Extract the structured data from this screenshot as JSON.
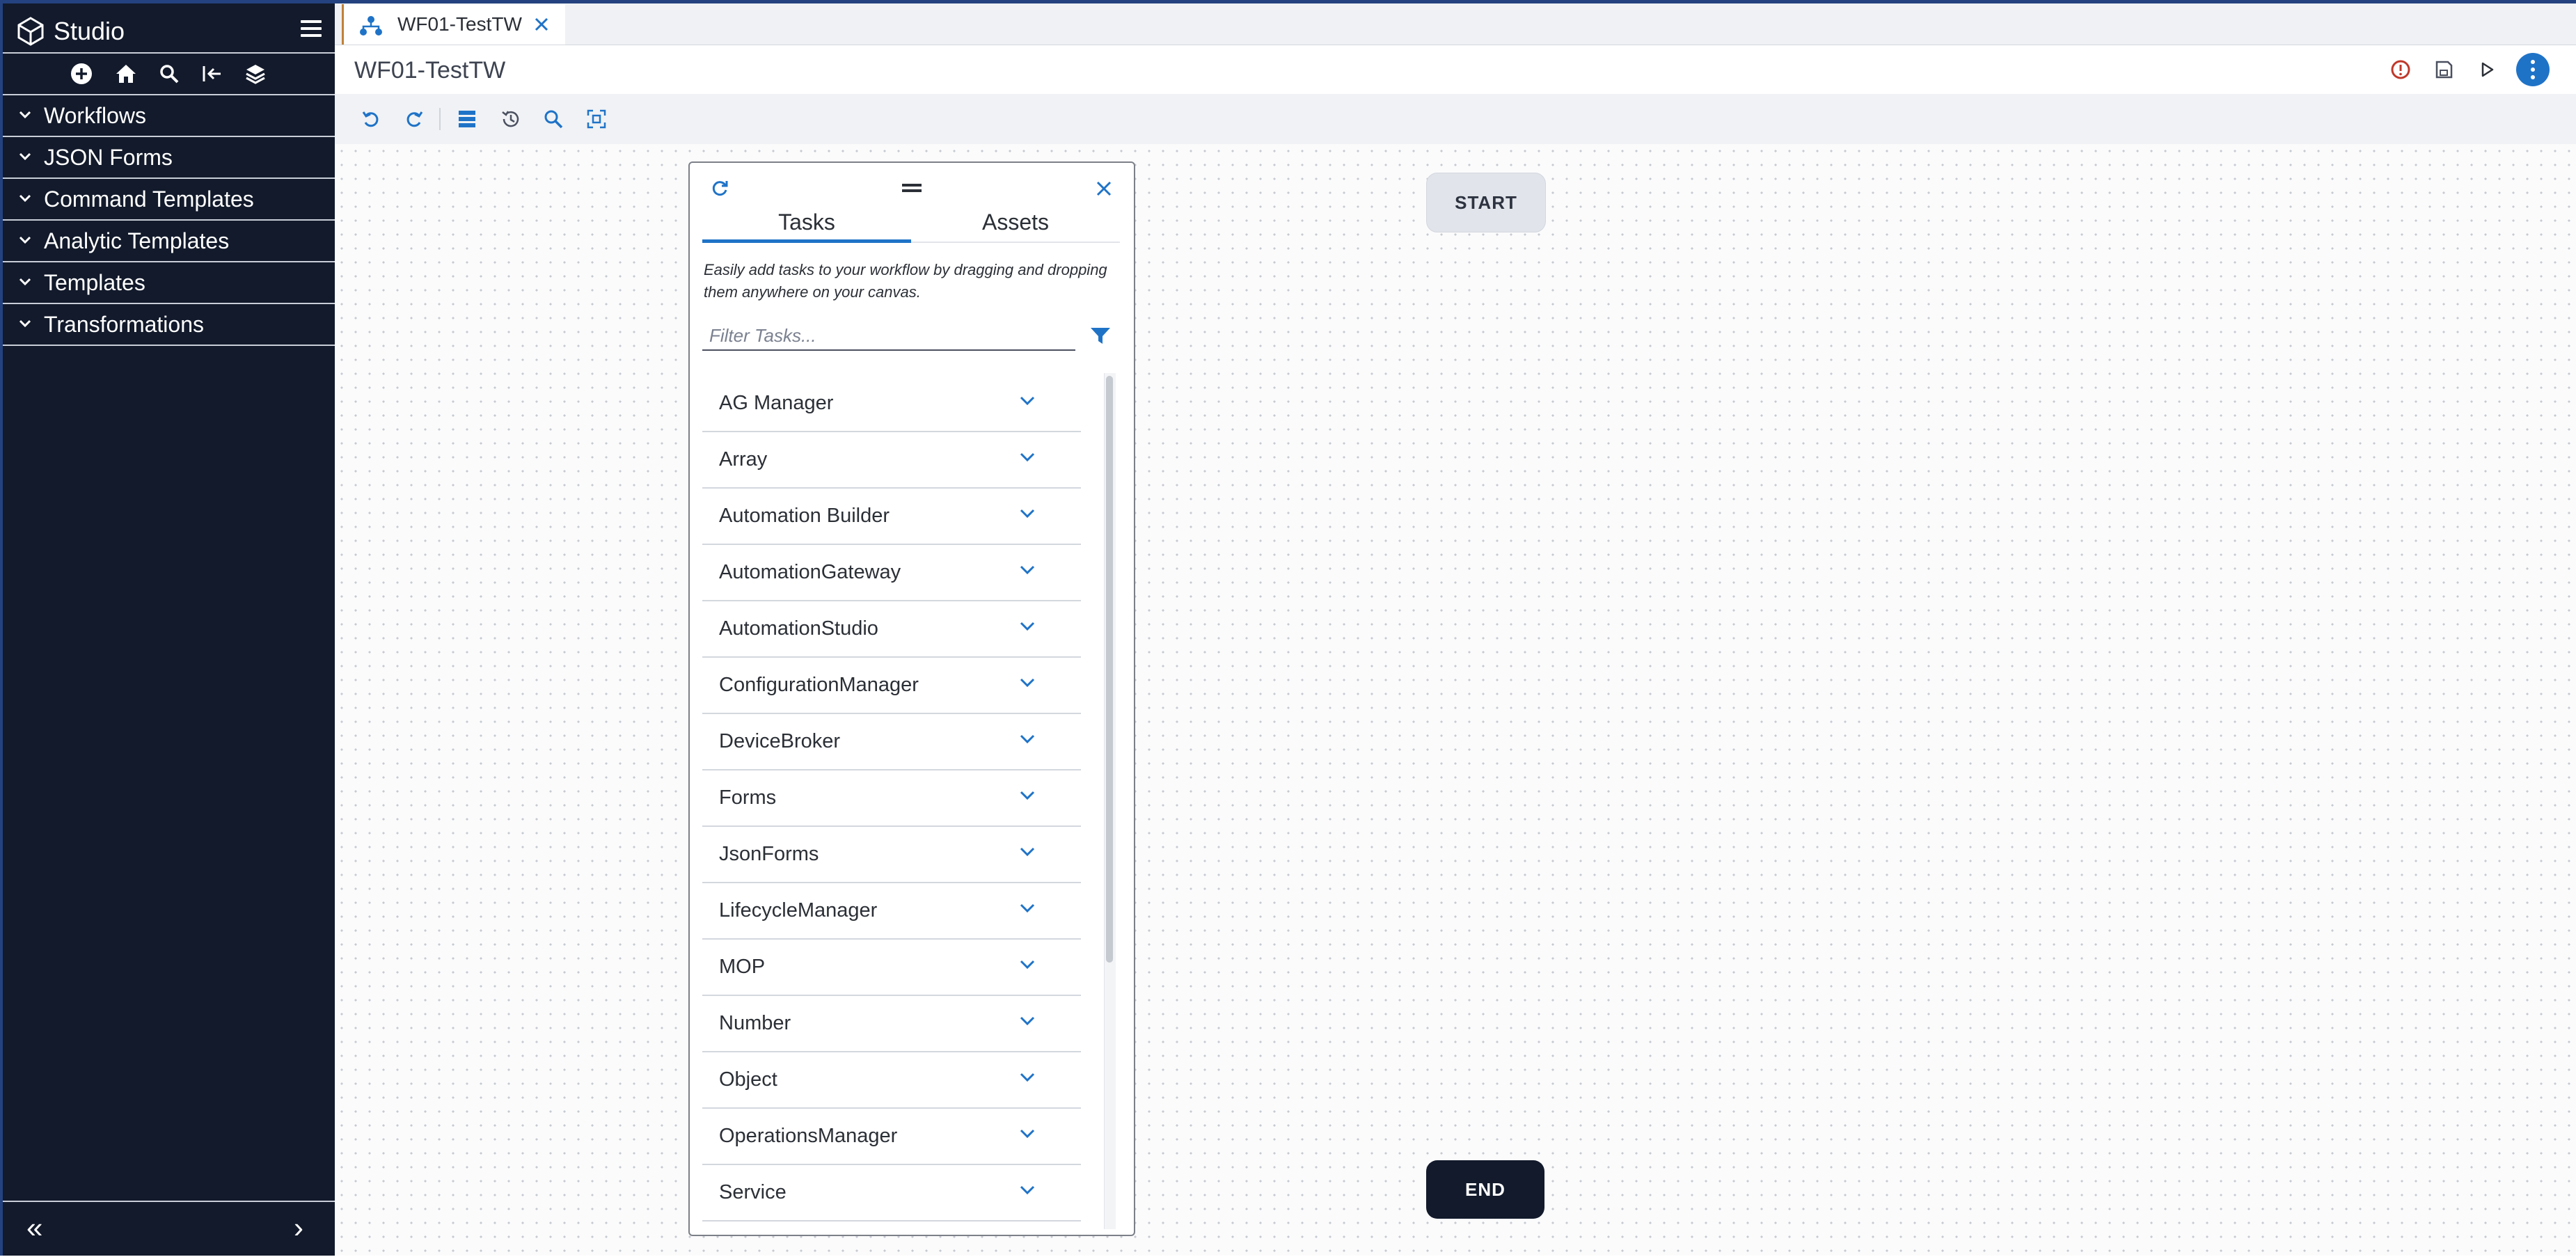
{
  "app": {
    "title": "Studio",
    "accent_color": "#1f73c7",
    "sidebar_bg": "#121a2b"
  },
  "sidebar": {
    "toolbar_icons": [
      "add-icon",
      "home-icon",
      "search-icon",
      "import-icon",
      "layers-icon"
    ],
    "items": [
      {
        "label": "Workflows"
      },
      {
        "label": "JSON Forms"
      },
      {
        "label": "Command Templates"
      },
      {
        "label": "Analytic Templates"
      },
      {
        "label": "Templates"
      },
      {
        "label": "Transformations"
      }
    ],
    "footer": {
      "collapse": "«",
      "expand": "›"
    }
  },
  "tabs": [
    {
      "title": "WF01-TestTW",
      "icon": "workflow-icon",
      "active": true
    }
  ],
  "header": {
    "title": "WF01-TestTW",
    "actions": [
      "error-icon",
      "save-icon",
      "run-icon",
      "more-icon"
    ]
  },
  "toolbar": {
    "icons": [
      "undo-icon",
      "redo-icon",
      "layout-icon",
      "history-icon",
      "search-icon",
      "fit-icon"
    ]
  },
  "panel": {
    "tabs": [
      "Tasks",
      "Assets"
    ],
    "active_tab": "Tasks",
    "hint": "Easily add tasks to your workflow by dragging and dropping them anywhere on your canvas.",
    "filter_placeholder": "Filter Tasks...",
    "filter_value": "",
    "tasks": [
      "AG Manager",
      "Array",
      "Automation Builder",
      "AutomationGateway",
      "AutomationStudio",
      "ConfigurationManager",
      "DeviceBroker",
      "Forms",
      "JsonForms",
      "LifecycleManager",
      "MOP",
      "Number",
      "Object",
      "OperationsManager",
      "Service"
    ]
  },
  "canvas": {
    "start_label": "START",
    "end_label": "END"
  }
}
